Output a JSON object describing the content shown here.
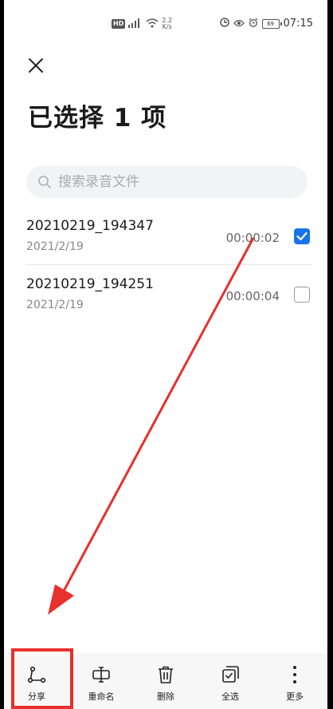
{
  "statusbar": {
    "hd": "HD",
    "speed_value": "2.2",
    "speed_unit": "K/s",
    "battery": "69",
    "time": "07:15"
  },
  "header": {
    "title": "已选择 1 项"
  },
  "search": {
    "placeholder": "搜索录音文件"
  },
  "recordings": [
    {
      "name": "20210219_194347",
      "date": "2021/2/19",
      "duration": "00:00:02",
      "checked": true
    },
    {
      "name": "20210219_194251",
      "date": "2021/2/19",
      "duration": "00:00:04",
      "checked": false
    }
  ],
  "toolbar": {
    "items": [
      {
        "label": "分享",
        "icon": "share-icon"
      },
      {
        "label": "重命名",
        "icon": "rename-icon"
      },
      {
        "label": "删除",
        "icon": "trash-icon"
      },
      {
        "label": "全选",
        "icon": "select-all-icon"
      },
      {
        "label": "更多",
        "icon": "more-vertical-icon"
      }
    ]
  },
  "colors": {
    "accent": "#1a73e8",
    "annotation": "#e8302c"
  }
}
